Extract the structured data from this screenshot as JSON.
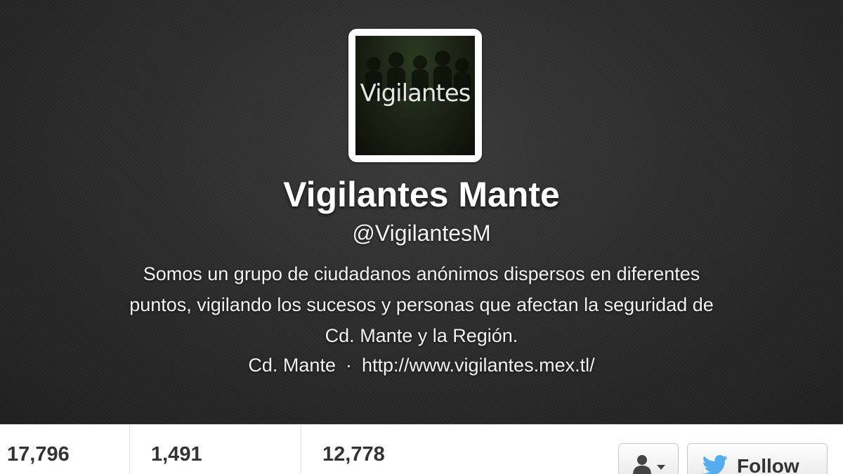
{
  "profile": {
    "avatar_text": "Vigilantes",
    "name": "Vigilantes Mante",
    "handle": "@VigilantesM",
    "bio_lines": [
      "Somos un grupo de ciudadanos anónimos dispersos en diferentes",
      "puntos, vigilando los sucesos y personas que afectan la seguridad de",
      "Cd. Mante y la Región."
    ],
    "location": "Cd. Mante",
    "separator": "·",
    "url": "http://www.vigilantes.mex.tl/"
  },
  "stats": [
    {
      "value": "17,796"
    },
    {
      "value": "1,491"
    },
    {
      "value": "12,778"
    }
  ],
  "actions": {
    "user_menu_icon": "person-icon",
    "follow_icon": "twitter-bird-icon",
    "follow_label": "Follow"
  },
  "colors": {
    "header_bg": "#2c2c2c",
    "twitter_blue": "#55acee",
    "text_on_dark": "#ffffff"
  }
}
